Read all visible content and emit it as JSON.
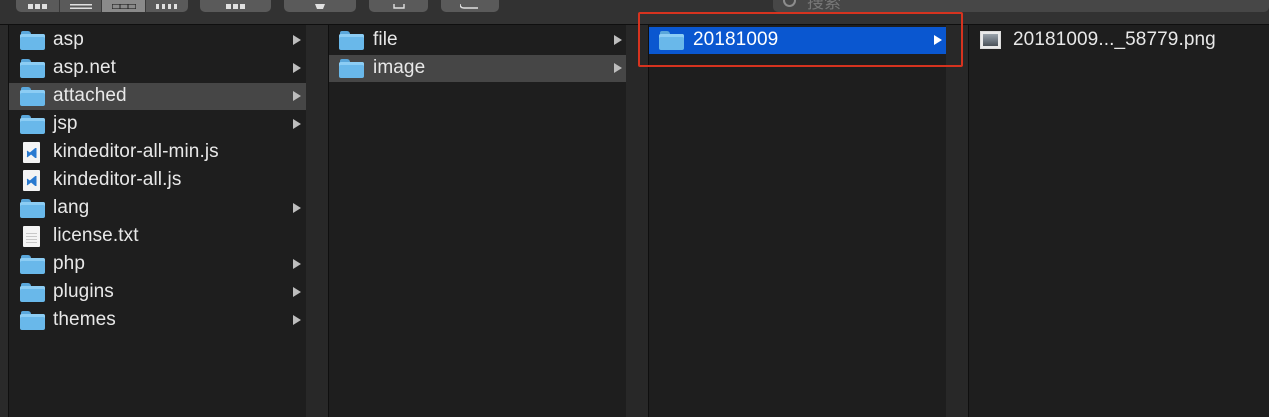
{
  "search": {
    "placeholder": "搜索"
  },
  "columns": [
    {
      "items": [
        {
          "label": "asp",
          "icon": "folder-icon",
          "has_children": true
        },
        {
          "label": "asp.net",
          "icon": "folder-icon",
          "has_children": true
        },
        {
          "label": "attached",
          "icon": "folder-icon",
          "has_children": true,
          "selected": true
        },
        {
          "label": "jsp",
          "icon": "folder-icon",
          "has_children": true
        },
        {
          "label": "kindeditor-all-min.js",
          "icon": "js-file-icon",
          "has_children": false
        },
        {
          "label": "kindeditor-all.js",
          "icon": "js-file-icon",
          "has_children": false
        },
        {
          "label": "lang",
          "icon": "folder-icon",
          "has_children": true
        },
        {
          "label": "license.txt",
          "icon": "text-file-icon",
          "has_children": false
        },
        {
          "label": "php",
          "icon": "folder-icon",
          "has_children": true
        },
        {
          "label": "plugins",
          "icon": "folder-icon",
          "has_children": true
        },
        {
          "label": "themes",
          "icon": "folder-icon",
          "has_children": true
        }
      ]
    },
    {
      "items": [
        {
          "label": "file",
          "icon": "folder-icon",
          "has_children": true
        },
        {
          "label": "image",
          "icon": "folder-icon",
          "has_children": true,
          "selected": true
        }
      ]
    },
    {
      "items": [
        {
          "label": "20181009",
          "icon": "folder-icon",
          "has_children": true,
          "selected": true,
          "active": true
        }
      ]
    },
    {
      "items": [
        {
          "label": "20181009..._58779.png",
          "icon": "image-file-icon",
          "has_children": false
        }
      ]
    }
  ],
  "colors": {
    "selection_active": "#0a57d0",
    "selection_inactive": "#464646",
    "annotation": "#d6331f"
  }
}
